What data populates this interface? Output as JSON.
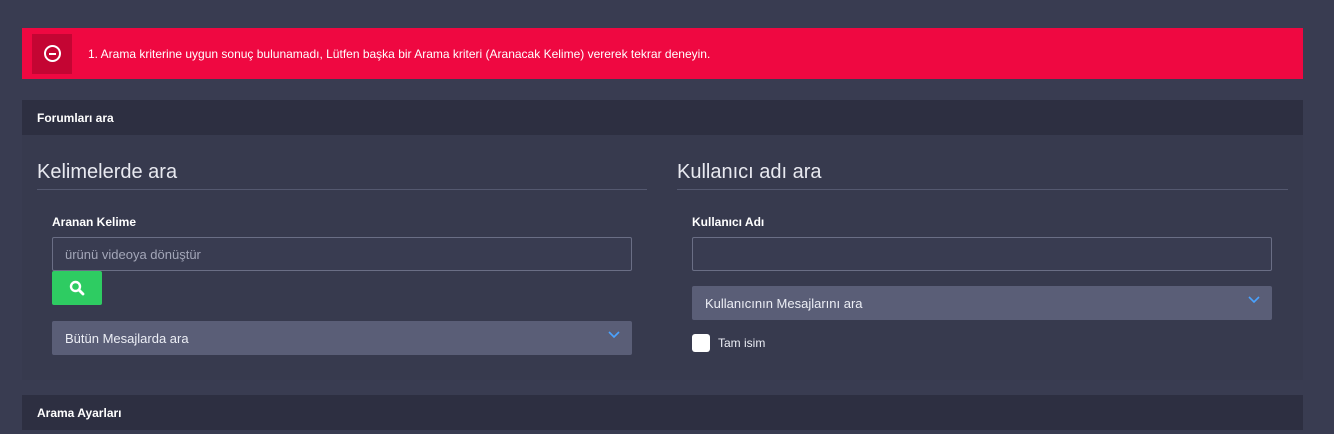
{
  "alert": {
    "message": "1. Arama kriterine uygun sonuç bulunamadı, Lütfen başka bir Arama kriteri (Aranacak Kelime) vererek tekrar deneyin.",
    "icon": "minus-circle-icon",
    "color": "#ef0841"
  },
  "search_panel": {
    "header": "Forumları ara",
    "keywords": {
      "title": "Kelimelerde ara",
      "field_label": "Aranan Kelime",
      "input_placeholder": "ürünü videoya dönüştür",
      "input_value": "",
      "search_icon": "search-icon",
      "scope_select": "Bütün Mesajlarda ara"
    },
    "username": {
      "title": "Kullanıcı adı ara",
      "field_label": "Kullanıcı Adı",
      "input_value": "",
      "mode_select": "Kullanıcının Mesajlarını ara",
      "exact_checkbox_label": "Tam isim",
      "exact_checked": false
    }
  },
  "settings_panel": {
    "header": "Arama Ayarları"
  },
  "colors": {
    "background": "#393c51",
    "panel_header": "#2d2f41",
    "search_button": "#2ecc62",
    "select_bg": "#5a5e77",
    "chevron": "#4aa3ff"
  }
}
